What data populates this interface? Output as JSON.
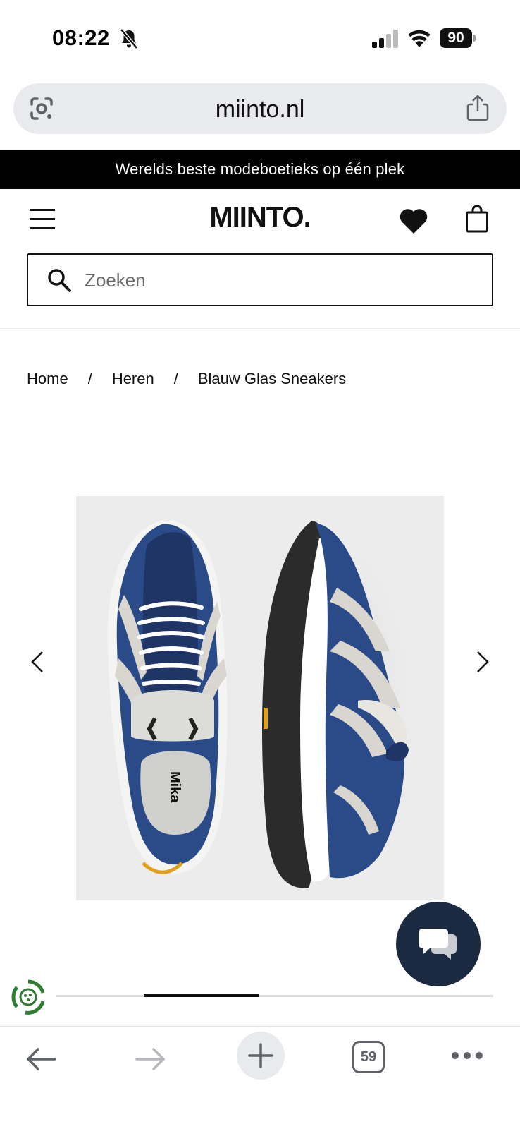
{
  "status_bar": {
    "time": "08:22",
    "battery": "90"
  },
  "browser": {
    "url": "miinto.nl",
    "tab_count": "59"
  },
  "promo": {
    "text": "Werelds beste modeboetieks op één plek"
  },
  "header": {
    "logo": "MIINTO."
  },
  "search": {
    "placeholder": "Zoeken"
  },
  "breadcrumb": {
    "items": [
      "Home",
      "Heren",
      "Blauw Glas Sneakers"
    ],
    "separator": "/"
  },
  "product": {
    "image_alt": "Blauw Glas Sneakers",
    "carousel_progress": {
      "start": 0.2,
      "end": 0.465
    }
  },
  "colors": {
    "promo_bg": "#000000",
    "chat_bg": "#1b2a41",
    "url_bar_bg": "#e8eaed",
    "image_bg": "#ececec",
    "sneaker_blue": "#2b4a88",
    "sneaker_grey": "#d9d6d0",
    "sole_dark": "#2b2b2b"
  },
  "icons": {
    "status": [
      "bell-slash-icon",
      "cellular-signal-icon",
      "wifi-icon",
      "battery-icon"
    ],
    "url_bar": [
      "google-lens-icon",
      "share-icon"
    ],
    "header": [
      "hamburger-menu-icon",
      "heart-icon",
      "shopping-bag-icon"
    ],
    "search": "search-icon",
    "carousel": [
      "chevron-left-icon",
      "chevron-right-icon"
    ],
    "chat": "chat-bubbles-icon",
    "sustainability": "recycle-icon",
    "toolbar": [
      "back-arrow-icon",
      "forward-arrow-icon",
      "plus-icon",
      "tabs-icon",
      "more-dots-icon"
    ]
  }
}
